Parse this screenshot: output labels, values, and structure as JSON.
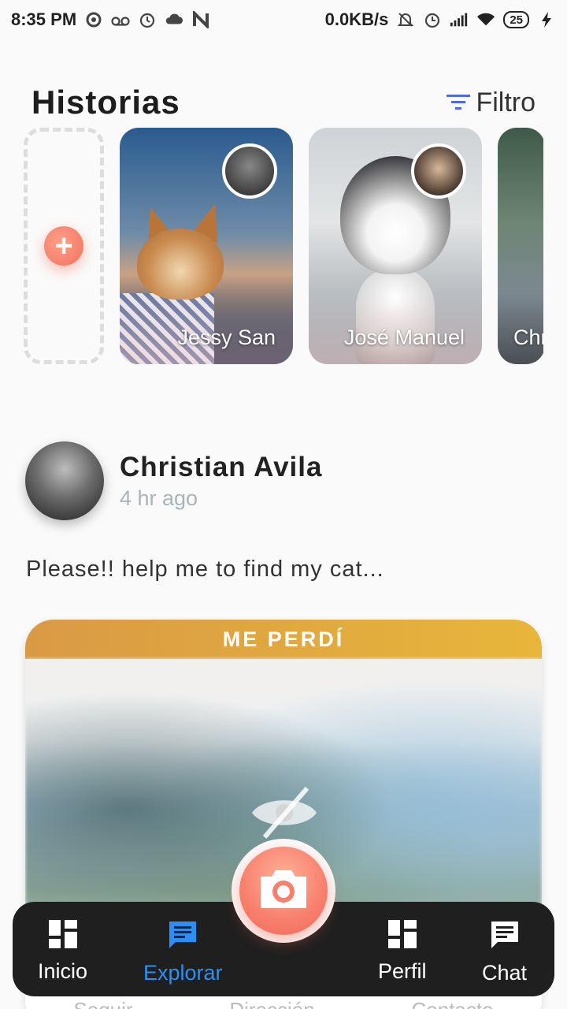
{
  "status_bar": {
    "time": "8:35 PM",
    "network_speed": "0.0KB/s",
    "battery_level": "25",
    "icons": [
      "media-icon",
      "voicemail-icon",
      "alarm-icon",
      "cloud-icon",
      "n-app-icon",
      "mute-icon",
      "alarm-icon",
      "signal-icon",
      "wifi-icon",
      "battery-icon",
      "charging-icon"
    ]
  },
  "stories": {
    "title": "Historias",
    "filter_label": "Filtro",
    "items": [
      {
        "name": "Jessy San"
      },
      {
        "name": "José Manuel"
      },
      {
        "name": "Chr"
      }
    ]
  },
  "post": {
    "author": "Christian Avila",
    "time_ago": "4 hr ago",
    "text": "Please!! help me to find my cat...",
    "badge": "ME PERDÍ",
    "actions": [
      "Seguir",
      "Dirección",
      "Contacto"
    ]
  },
  "nav": {
    "items": [
      {
        "label": "Inicio",
        "icon": "dashboard-icon"
      },
      {
        "label": "Explorar",
        "icon": "chat-bubble-icon",
        "active": true
      },
      {
        "label": "Perfil",
        "icon": "dashboard-icon"
      },
      {
        "label": "Chat",
        "icon": "chat-bubble-icon"
      }
    ],
    "center_icon": "camera-icon"
  },
  "colors": {
    "accent": "#2c8ff5",
    "camera": "#f77f6c",
    "badge": "#e0a640",
    "nav_bg": "#1f1f1f"
  }
}
